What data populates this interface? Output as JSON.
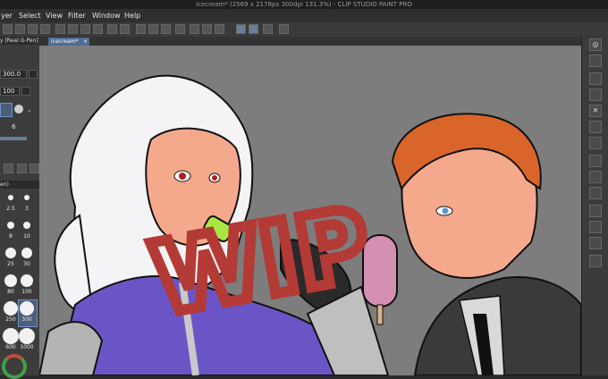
{
  "window": {
    "title": "icecream* (2569 x 2178px 300dpi 131.3%) - CLIP STUDIO PAINT PRO"
  },
  "menu": {
    "items": [
      "yer",
      "Select",
      "View",
      "Filter",
      "Window",
      "Help"
    ]
  },
  "tool_panel": {
    "brush_title": "y [Real G-Pen]",
    "size_value": "300.0",
    "opacity_value": "100",
    "stabilizer_value": "6",
    "brush_size_header": "en)"
  },
  "brush_sizes": [
    "2.5",
    "3",
    "8",
    "10",
    "25",
    "30",
    "80",
    "100",
    "250",
    "300",
    "600",
    "1000"
  ],
  "selected_brush_size": "300",
  "document_tab": {
    "label": "icecream*",
    "close": "×"
  },
  "canvas": {
    "watermark_text": "WIP"
  },
  "colors": {
    "ui_bg": "#3c3c3c",
    "canvas_bg": "#7d7d7d",
    "accent": "#4f6c93",
    "wip_red": "#b43a36"
  }
}
